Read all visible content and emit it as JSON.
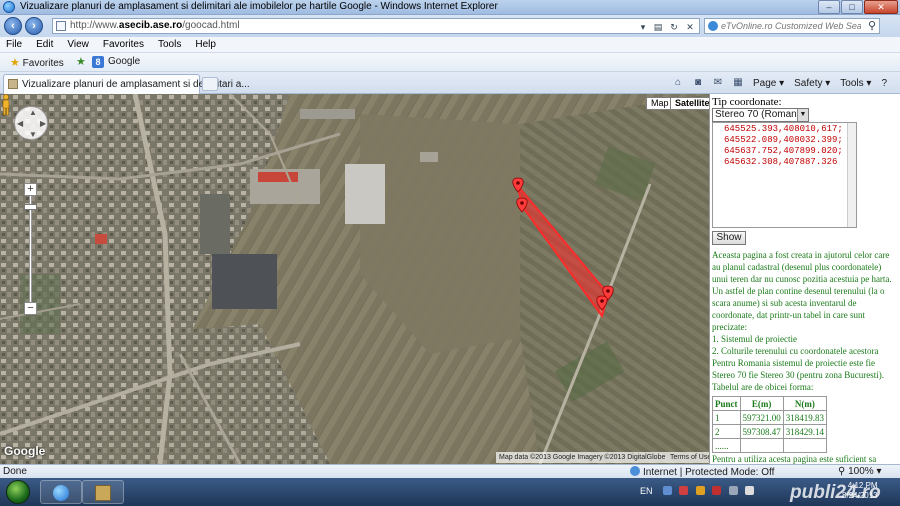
{
  "window": {
    "title": "Vizualizare planuri de amplasament si delimitari ale imobilelor pe hartile Google - Windows Internet Explorer"
  },
  "address": {
    "url_prefix": "http://www.",
    "url_domain": "asecib.ase.ro",
    "url_path": "/goocad.html"
  },
  "search": {
    "placeholder": "eTvOnline.ro Customized Web Search"
  },
  "menu": [
    "File",
    "Edit",
    "View",
    "Favorites",
    "Tools",
    "Help"
  ],
  "favorites": {
    "label": "Favorites",
    "google": "Google"
  },
  "tab": {
    "label": "Vizualizare planuri de amplasament si delimitari a..."
  },
  "commandbar": {
    "page": "Page ▾",
    "safety": "Safety ▾",
    "tools": "Tools ▾",
    "help": "?"
  },
  "map": {
    "type_map": "Map",
    "type_satellite": "Satellite",
    "logo": "Google",
    "copyright": "Map data ©2013 Google Imagery ©2013 DigitalGlobe",
    "terms": "Terms of Use",
    "markers": 4,
    "polygon_color": "#ff2a2a"
  },
  "panel": {
    "title": "Tip coordonate:",
    "projection": "Stereo 70 (Romania)",
    "coordinates": "645525.393,408010,617;645522.089,408032.399;645637.752,407899.020;645632.308,407887.326",
    "show": "Show",
    "desc1": "Aceasta pagina a fost creata in ajutorul celor care au planul cadastral (desenul plus coordonatele) unui teren dar nu cunosc pozitia acestuia pe harta. Un astfel de plan contine desenul terenului (la o scara anume) si sub acesta inventarul de coordonate, dat printr-un tabel in care sunt precizate:",
    "item1": "1. Sistemul de proiectie",
    "item2": "2. Colturile terenului cu coordonatele acestora",
    "desc2": "Pentru Romania sistemul de proiectie este fie Stereo 70 fie Stereo 30 (pentru zona Bucuresti). Tabelul are de obicei forma:",
    "table": {
      "headers": [
        "Punct",
        "E(m)",
        "N(m)"
      ],
      "rows": [
        [
          "1",
          "597321.00",
          "318419.83"
        ],
        [
          "2",
          "597308.47",
          "318429.14"
        ]
      ],
      "ellipsis": "......"
    },
    "foot": "Pentru a utiliza acesta pagina este suficient sa"
  },
  "status": {
    "done": "Done",
    "zone": "Internet | Protected Mode: Off",
    "zoom": "100%"
  },
  "taskbar": {
    "lang": "EN",
    "time": "4:12 PM",
    "date": "8/24/2013"
  },
  "watermark": "publi24.ro"
}
